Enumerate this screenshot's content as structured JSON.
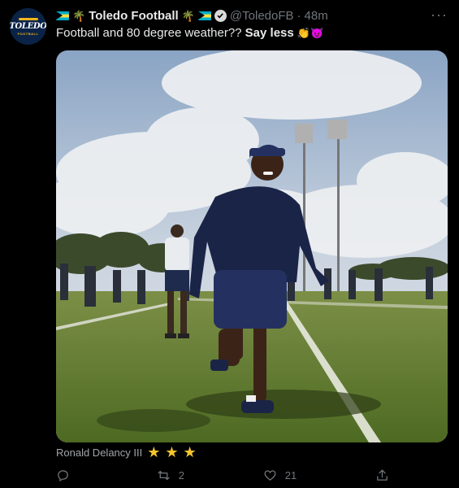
{
  "tweet": {
    "author_name": "Toledo Football",
    "handle": "@ToledoFB",
    "separator": "·",
    "time": "48m",
    "text_prefix": "Football and 80 degree weather?? ",
    "text_bold": "Say less",
    "more_label": "···"
  },
  "avatar": {
    "title": "TOLEDO",
    "subtitle": "FOOTBALL"
  },
  "media_tag": {
    "text": "Ronald Delancy III",
    "stars": 3
  },
  "actions": {
    "reply_count": "",
    "retweet_count": "2",
    "like_count": "21",
    "share_count": ""
  },
  "icons": [
    "verified-icon",
    "reply-icon",
    "retweet-icon",
    "like-icon",
    "share-icon",
    "clap-emoji",
    "devil-emoji",
    "palm-tree-emoji",
    "bahamas-flag-icon",
    "star-icon"
  ],
  "colors": {
    "background": "#000000",
    "text": "#e7e9ea",
    "muted": "#71767b",
    "star": "#f7c52b",
    "brand_navy": "#0b2347",
    "brand_gold": "#f2b51d"
  }
}
